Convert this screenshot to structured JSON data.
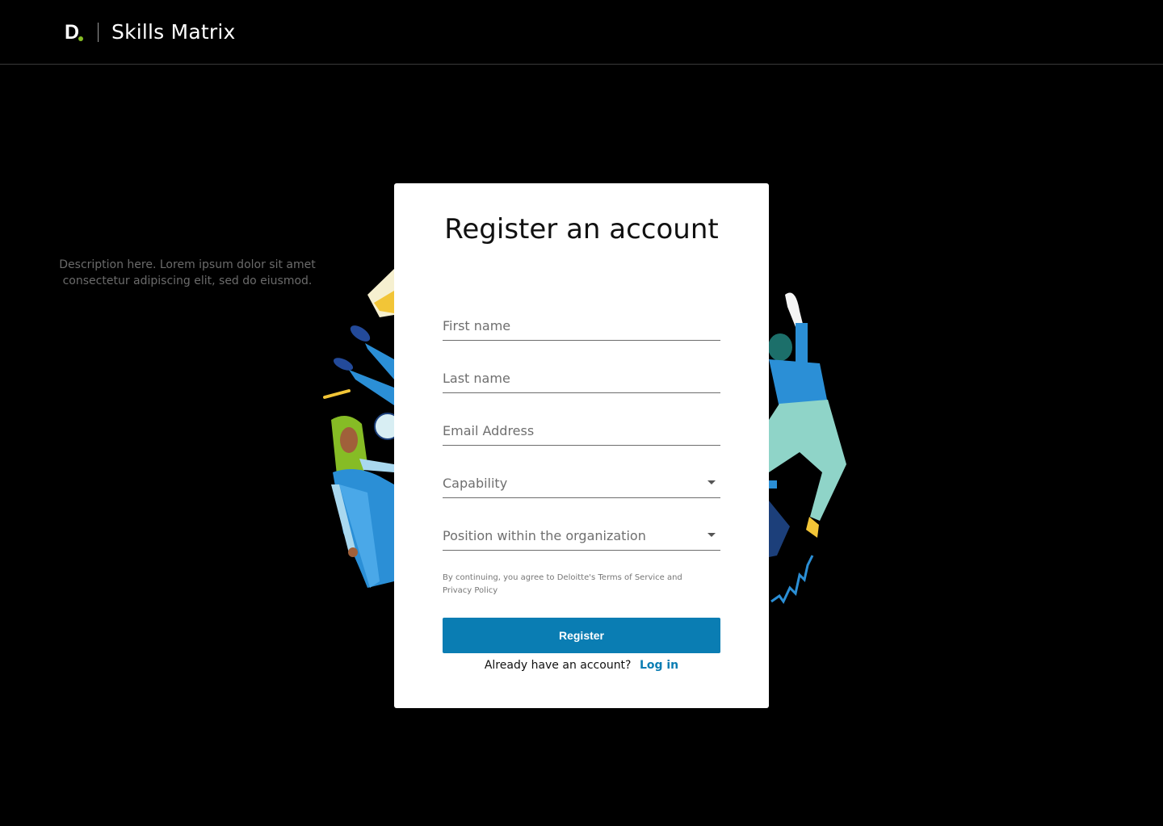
{
  "header": {
    "logo_letter": "D",
    "app_title": "Skills Matrix"
  },
  "card": {
    "title": "Register an account",
    "description": "Description here. Lorem ipsum dolor sit amet consectetur adipiscing elit, sed do eiusmod.",
    "fields": {
      "first_name": {
        "placeholder": "First name",
        "value": ""
      },
      "last_name": {
        "placeholder": "Last name",
        "value": ""
      },
      "email": {
        "placeholder": "Email Address",
        "value": ""
      },
      "capability": {
        "placeholder": "Capability"
      },
      "position": {
        "placeholder": "Position within the organization"
      }
    },
    "terms": "By continuing, you agree to Deloitte's Terms of Service and Privacy Policy",
    "register_label": "Register",
    "login_prompt": "Already have an account?",
    "login_link": "Log in"
  },
  "colors": {
    "accent": "#0a7db3",
    "brand_dot": "#86bc25",
    "background": "#000000",
    "card": "#ffffff"
  },
  "icons": {
    "logo": "deloitte-logo",
    "select_caret": "caret-down-icon"
  }
}
